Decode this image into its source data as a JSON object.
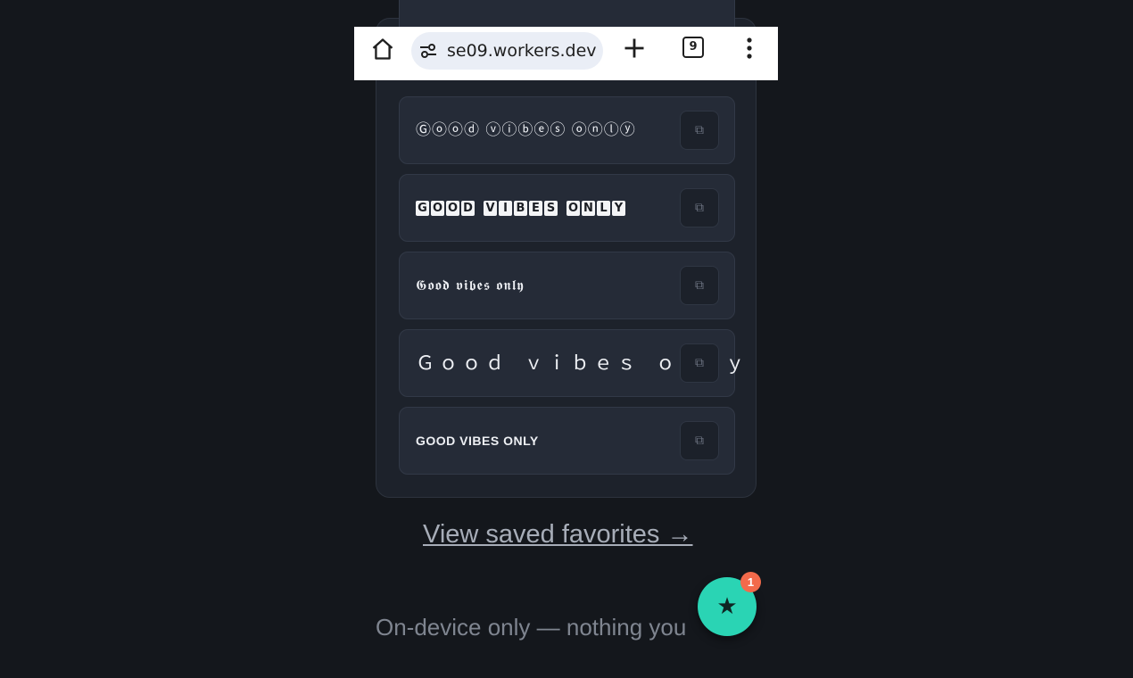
{
  "browser": {
    "url": "se09.workers.dev",
    "tab_count": "9",
    "icons": [
      "home-icon",
      "tune-icon",
      "plus-icon",
      "tabs-icon",
      "more-vert-icon"
    ]
  },
  "results": [
    {
      "text": "Ⓖⓞⓞⓓ ⓥⓘⓑⓔⓢ ⓞⓝⓛⓨ",
      "copy_glyph": "⧉"
    },
    {
      "text": "GOOD VIBES ONLY",
      "copy_glyph": "⧉"
    },
    {
      "text": "𝕲𝖔𝖔𝖉 𝖛𝖎𝖇𝖊𝖘 𝖔𝖓𝖑𝖞",
      "copy_glyph": "⧉"
    },
    {
      "text": "Ｇｏｏｄ ｖｉｂｅｓ ｏｎｌｙ",
      "copy_glyph": "⧉"
    },
    {
      "text": "GOOD VIBES ONLY",
      "copy_glyph": "⧉"
    }
  ],
  "favorites_link": "View saved favorites →",
  "footer_text": "On-device only — nothing you",
  "fab": {
    "icon": "★",
    "badge": "1"
  },
  "colors": {
    "background": "#14171c",
    "accent": "#2ad4b4",
    "badge": "#f26a4b"
  }
}
